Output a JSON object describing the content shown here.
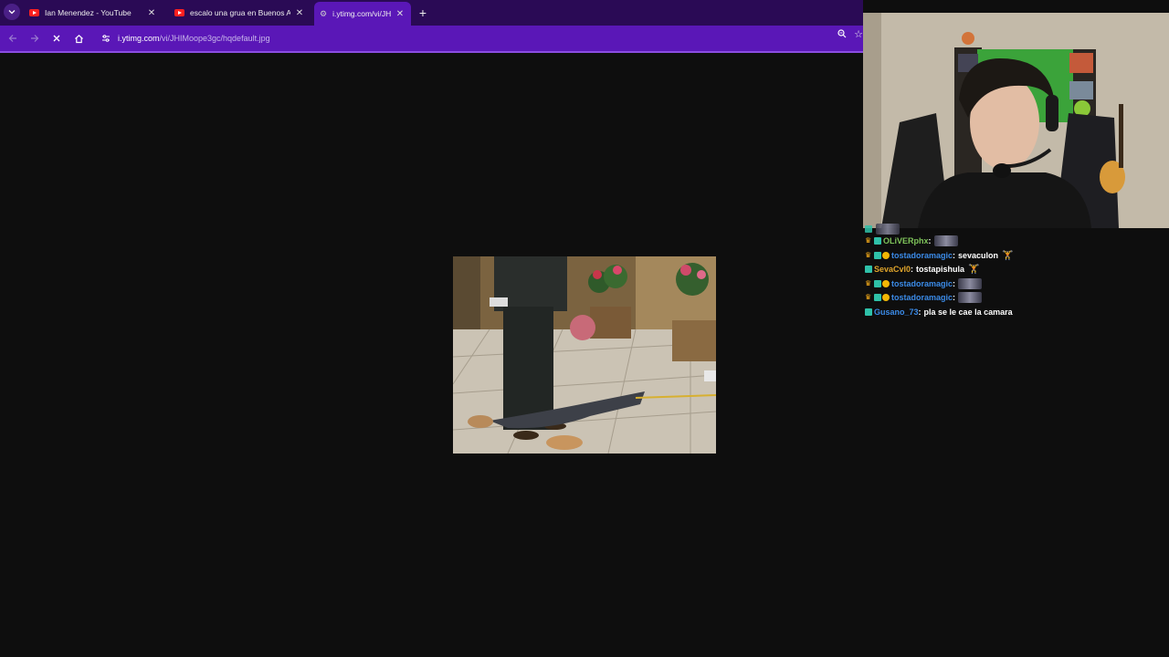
{
  "browser": {
    "tabs": [
      {
        "label": "Ian Menendez - YouTube",
        "favicon": "youtube-icon"
      },
      {
        "label": "escalo una grua en Buenos Aire",
        "favicon": "youtube-icon"
      },
      {
        "label": "i.ytimg.com/vi/JH",
        "favicon": "loading-icon",
        "active": true
      }
    ],
    "new_tab_label": "+",
    "close_glyph": "✕",
    "url_host": "i.ytimg.com",
    "url_path": "/vi/JHIMoope3gc/hqdefault.jpg"
  },
  "chat": {
    "messages": [
      {
        "user": "OLiVERphx",
        "user_color": "#7ec35a",
        "badges": [
          "crown",
          "mod"
        ],
        "text": "",
        "emote": true,
        "emoji": ""
      },
      {
        "user": "tostadoramagic",
        "user_color": "#3b8be8",
        "badges": [
          "crown",
          "mod",
          "coin"
        ],
        "text": "sevaculon",
        "emote": false,
        "emoji": "🏋"
      },
      {
        "user": "SevaCvl0",
        "user_color": "#e0a52b",
        "badges": [
          "mod"
        ],
        "text": "tostapishula",
        "emote": false,
        "emoji": "🏋"
      },
      {
        "user": "tostadoramagic",
        "user_color": "#3b8be8",
        "badges": [
          "crown",
          "mod",
          "coin"
        ],
        "text": "",
        "emote": true,
        "emoji": ""
      },
      {
        "user": "tostadoramagic",
        "user_color": "#3b8be8",
        "badges": [
          "crown",
          "mod",
          "coin"
        ],
        "text": "",
        "emote": true,
        "emoji": ""
      },
      {
        "user": "Gusano_73",
        "user_color": "#3b8be8",
        "badges": [
          "mod"
        ],
        "text": "pla se le cae la camara",
        "emote": false,
        "emoji": ""
      }
    ]
  }
}
